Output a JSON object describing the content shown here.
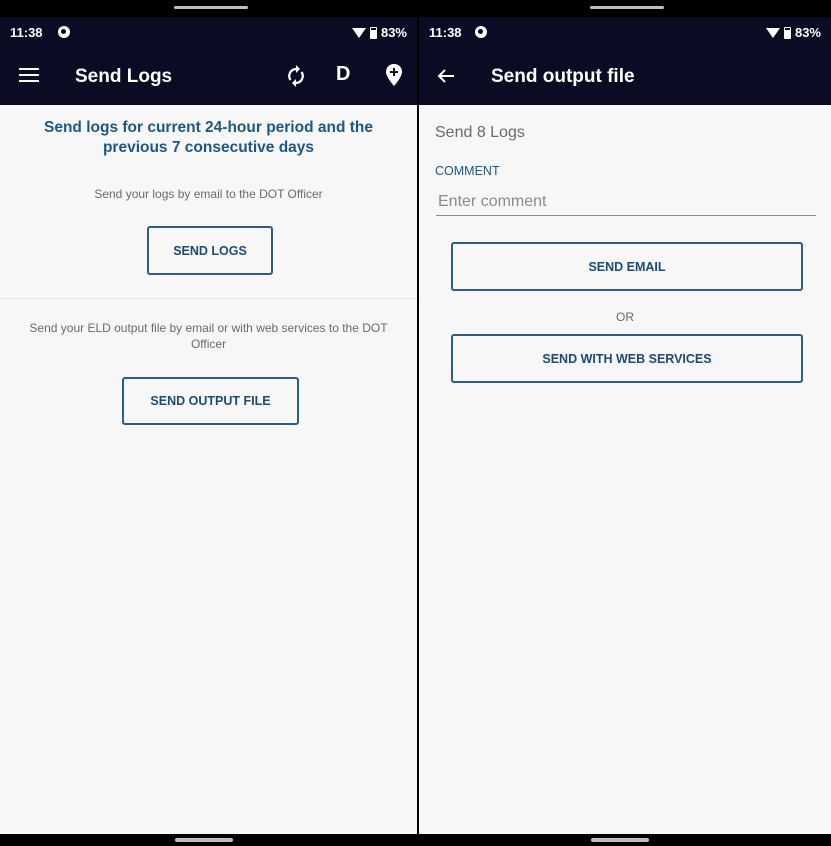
{
  "left_screen": {
    "status": {
      "time": "11:38",
      "battery": "83%"
    },
    "app_bar": {
      "title": "Send Logs",
      "driver_status": "D"
    },
    "heading": "Send logs for current 24-hour period and the previous 7 consecutive days",
    "logs_description": "Send your logs by email to the DOT Officer",
    "send_logs_label": "SEND LOGS",
    "output_description": "Send your ELD output file by email or with web services to the DOT Officer",
    "send_output_label": "SEND OUTPUT FILE"
  },
  "right_screen": {
    "status": {
      "time": "11:38",
      "battery": "83%"
    },
    "app_bar": {
      "title": "Send output file"
    },
    "send_count": "Send 8 Logs",
    "comment_label": "COMMENT",
    "comment_placeholder": "Enter comment",
    "comment_value": "",
    "send_email_label": "SEND EMAIL",
    "or_label": "OR",
    "send_web_label": "SEND WITH WEB SERVICES"
  },
  "colors": {
    "app_bar": "#0b0b24",
    "accent": "#1e5784",
    "button_border": "#2f5b84",
    "background": "#f7f7f7"
  },
  "icons": [
    "menu-icon",
    "sync-icon",
    "location-pin-icon",
    "back-arrow-icon",
    "wifi-icon",
    "battery-icon"
  ]
}
